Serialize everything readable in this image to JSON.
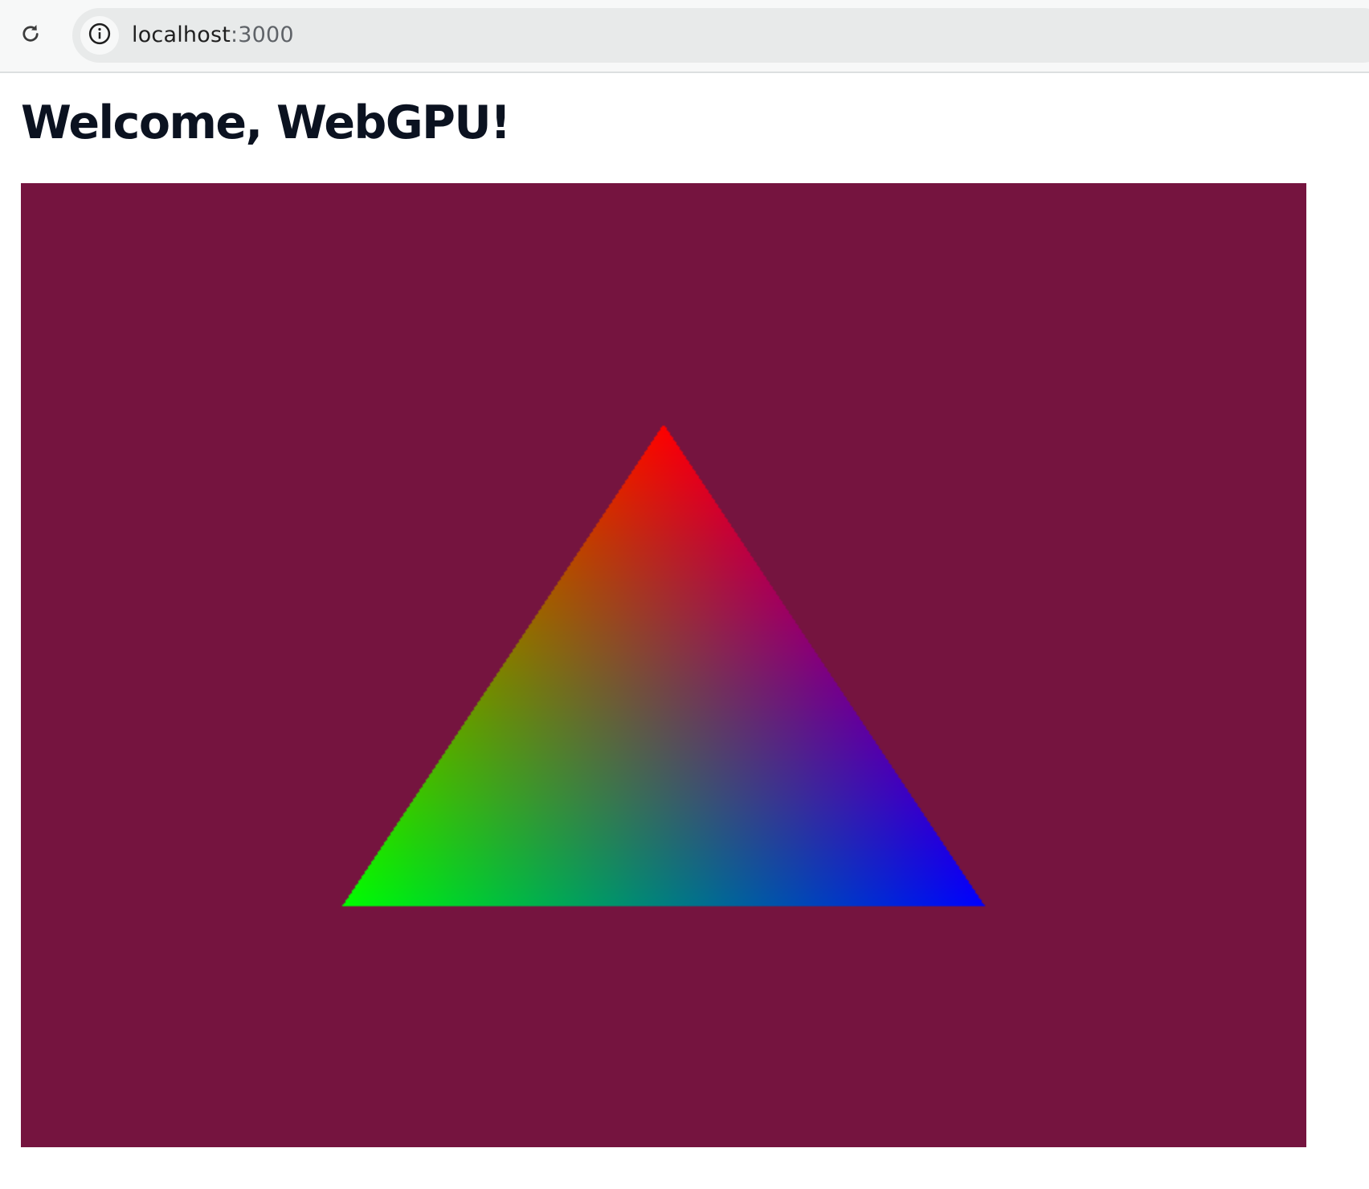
{
  "browser": {
    "url_host": "localhost",
    "url_port": ":3000",
    "reload_icon": "reload-icon",
    "site_info_icon": "info-icon"
  },
  "page": {
    "title": "Welcome, WebGPU!"
  },
  "canvas": {
    "clear_color": "#75143f",
    "triangle": {
      "top_color": "#ff0000",
      "left_color": "#00ff00",
      "right_color": "#0000ff"
    }
  }
}
